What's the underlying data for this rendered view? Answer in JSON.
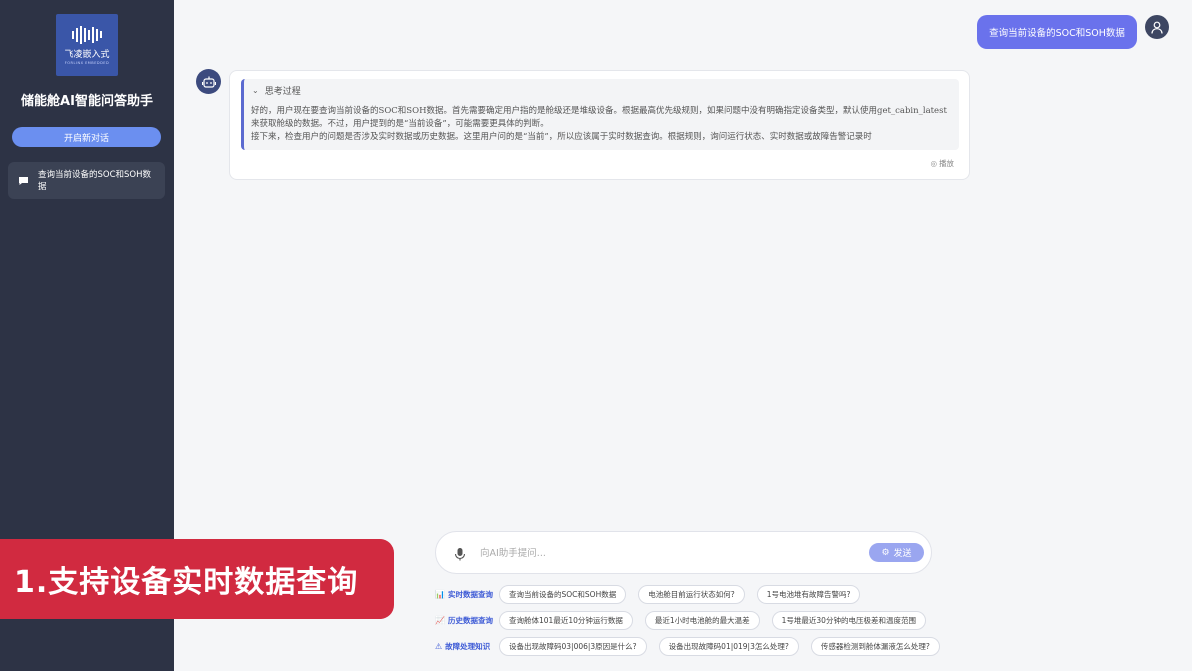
{
  "sidebar": {
    "logo_text_cn": "飞凌嵌入式",
    "logo_text_en": "FORLINX EMBEDDED",
    "app_title": "储能舱AI智能问答助手",
    "new_chat_label": "开启新对话",
    "history": [
      {
        "label": "查询当前设备的SOC和SOH数据"
      }
    ]
  },
  "chat": {
    "user_message": "查询当前设备的SOC和SOH数据",
    "thinking_header": "思考过程",
    "thinking_text": "好的，用户现在要查询当前设备的SOC和SOH数据。首先需要确定用户指的是舱级还是堆级设备。根据最高优先级规则，如果问题中没有明确指定设备类型，默认使用get_cabin_latest来获取舱级的数据。不过，用户提到的是“当前设备”，可能需要更具体的判断。",
    "thinking_text_2": "接下来，检查用户的问题是否涉及实时数据或历史数据。这里用户问的是“当前”，所以应该属于实时数据查询。根据规则，询问运行状态、实时数据或故障告警记录时",
    "play_label": "播放"
  },
  "input": {
    "placeholder": "向AI助手提问...",
    "send_label": "发送"
  },
  "quick_questions": [
    {
      "category": "实时数据查询",
      "icon": "chart-icon",
      "items": [
        "查询当前设备的SOC和SOH数据",
        "电池舱目前运行状态如何?",
        "1号电池堆有故障告警吗?"
      ]
    },
    {
      "category": "历史数据查询",
      "icon": "trend-icon",
      "items": [
        "查询舱体101最近10分钟运行数据",
        "最近1小时电池舱的最大温差",
        "1号堆最近30分钟的电压极差和温度范围"
      ]
    },
    {
      "category": "故障处理知识",
      "icon": "warning-icon",
      "items": [
        "设备出现故障码03|006|3原因是什么?",
        "设备出现故障码01|019|3怎么处理?",
        "传感器检测到舱体漏液怎么处理?"
      ]
    }
  ],
  "banner": {
    "text": "1.支持设备实时数据查询"
  },
  "colors": {
    "sidebar_bg": "#2d3345",
    "accent": "#6a72ec",
    "banner": "#d12a40"
  }
}
